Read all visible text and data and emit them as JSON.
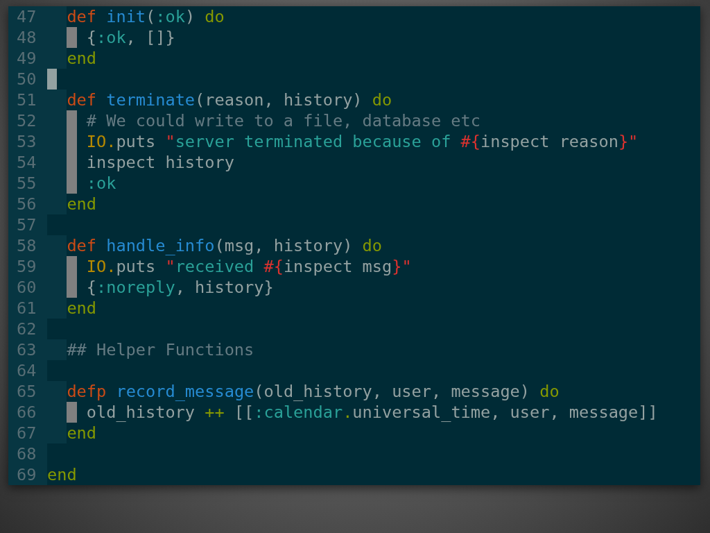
{
  "lines": [
    {
      "number": "47",
      "cursor": false,
      "kind": "nested",
      "tokens": [
        {
          "text": "def ",
          "kind": "keyword"
        },
        {
          "text": "init",
          "kind": "function"
        },
        {
          "text": "(",
          "kind": "plain"
        },
        {
          "text": ":ok",
          "kind": "atom"
        },
        {
          "text": ") ",
          "kind": "plain"
        },
        {
          "text": "do",
          "kind": "block"
        }
      ]
    },
    {
      "number": "48",
      "cursor": false,
      "kind": "deep",
      "tokens": [
        {
          "text": "{",
          "kind": "plain"
        },
        {
          "text": ":ok",
          "kind": "atom"
        },
        {
          "text": ", []}",
          "kind": "plain"
        }
      ]
    },
    {
      "number": "49",
      "cursor": false,
      "kind": "nested",
      "tokens": [
        {
          "text": "end",
          "kind": "block"
        }
      ]
    },
    {
      "number": "50",
      "cursor": true
    },
    {
      "number": "51",
      "cursor": false,
      "kind": "nested",
      "tokens": [
        {
          "text": "def ",
          "kind": "keyword"
        },
        {
          "text": "terminate",
          "kind": "function"
        },
        {
          "text": "(reason, history) ",
          "kind": "plain"
        },
        {
          "text": "do",
          "kind": "block"
        }
      ]
    },
    {
      "number": "52",
      "cursor": false,
      "kind": "deep",
      "tokens": [
        {
          "text": "# We could write to a file, database etc",
          "kind": "comment"
        }
      ]
    },
    {
      "number": "53",
      "cursor": false,
      "kind": "deep",
      "tokens": [
        {
          "text": "IO.",
          "kind": "module"
        },
        {
          "text": "puts ",
          "kind": "plain"
        },
        {
          "text": "\"",
          "kind": "interp"
        },
        {
          "text": "server terminated because of ",
          "kind": "string"
        },
        {
          "text": "#{",
          "kind": "interp"
        },
        {
          "text": "inspect reason",
          "kind": "plain"
        },
        {
          "text": "}\"",
          "kind": "interp"
        }
      ]
    },
    {
      "number": "54",
      "cursor": false,
      "kind": "deep",
      "tokens": [
        {
          "text": "inspect history",
          "kind": "plain"
        }
      ]
    },
    {
      "number": "55",
      "cursor": false,
      "kind": "deep",
      "tokens": [
        {
          "text": ":ok",
          "kind": "atom"
        }
      ]
    },
    {
      "number": "56",
      "cursor": false,
      "kind": "nested",
      "tokens": [
        {
          "text": "end",
          "kind": "block"
        }
      ]
    },
    {
      "number": "57",
      "cursor": false
    },
    {
      "number": "58",
      "cursor": false,
      "kind": "nested",
      "tokens": [
        {
          "text": "def ",
          "kind": "keyword"
        },
        {
          "text": "handle_info",
          "kind": "function"
        },
        {
          "text": "(msg, history) ",
          "kind": "plain"
        },
        {
          "text": "do",
          "kind": "block"
        }
      ]
    },
    {
      "number": "59",
      "cursor": false,
      "kind": "deep",
      "tokens": [
        {
          "text": "IO.",
          "kind": "module"
        },
        {
          "text": "puts ",
          "kind": "plain"
        },
        {
          "text": "\"",
          "kind": "interp"
        },
        {
          "text": "received ",
          "kind": "string"
        },
        {
          "text": "#{",
          "kind": "interp"
        },
        {
          "text": "inspect msg",
          "kind": "plain"
        },
        {
          "text": "}\"",
          "kind": "interp"
        }
      ]
    },
    {
      "number": "60",
      "cursor": false,
      "kind": "deep",
      "tokens": [
        {
          "text": "{",
          "kind": "plain"
        },
        {
          "text": ":noreply",
          "kind": "atom"
        },
        {
          "text": ", history}",
          "kind": "plain"
        }
      ]
    },
    {
      "number": "61",
      "cursor": false,
      "kind": "nested",
      "tokens": [
        {
          "text": "end",
          "kind": "block"
        }
      ]
    },
    {
      "number": "62",
      "cursor": false
    },
    {
      "number": "63",
      "cursor": false,
      "kind": "nested",
      "tokens": [
        {
          "text": "## Helper Functions",
          "kind": "comment"
        }
      ]
    },
    {
      "number": "64",
      "cursor": false
    },
    {
      "number": "65",
      "cursor": false,
      "kind": "nested",
      "tokens": [
        {
          "text": "defp ",
          "kind": "keyword"
        },
        {
          "text": "record_message",
          "kind": "function"
        },
        {
          "text": "(old_history, user, message) ",
          "kind": "plain"
        },
        {
          "text": "do",
          "kind": "block"
        }
      ]
    },
    {
      "number": "66",
      "cursor": false,
      "kind": "deep",
      "tokens": [
        {
          "text": "old_history ",
          "kind": "plain"
        },
        {
          "text": "++",
          "kind": "operator"
        },
        {
          "text": " [[",
          "kind": "plain"
        },
        {
          "text": ":calendar",
          "kind": "atom"
        },
        {
          "text": ".",
          "kind": "operator"
        },
        {
          "text": "universal_time, user, message]]",
          "kind": "plain"
        }
      ]
    },
    {
      "number": "67",
      "cursor": false,
      "kind": "nested",
      "tokens": [
        {
          "text": "end",
          "kind": "block"
        }
      ]
    },
    {
      "number": "68",
      "cursor": false
    },
    {
      "number": "69",
      "cursor": false,
      "tokens": [
        {
          "text": "end",
          "kind": "block"
        }
      ]
    }
  ]
}
